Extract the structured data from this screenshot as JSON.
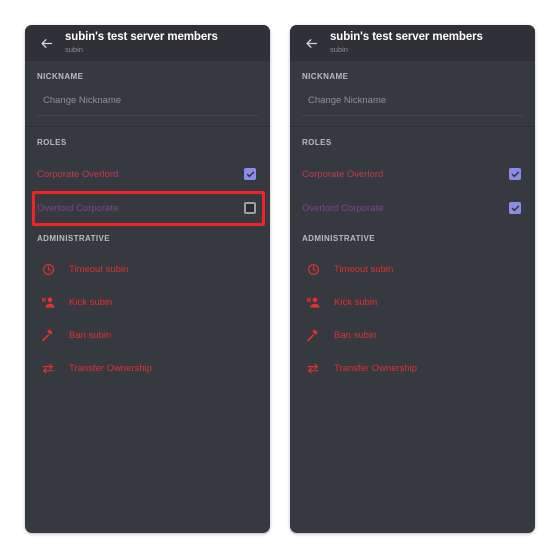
{
  "panels": [
    {
      "id": "left",
      "header": {
        "back_icon": "back-arrow-icon",
        "title": "subin's test server members",
        "subtitle": "subin"
      },
      "nickname": {
        "section_label": "NICKNAME",
        "placeholder": "Change Nickname",
        "value": ""
      },
      "roles": {
        "section_label": "ROLES",
        "items": [
          {
            "label": "Corporate Overlord",
            "color": "#c03b52",
            "checked": true,
            "highlighted": false
          },
          {
            "label": "Overlord Corporate",
            "color": "#81438c",
            "checked": false,
            "highlighted": true
          }
        ]
      },
      "administrative": {
        "section_label": "ADMINISTRATIVE",
        "items": [
          {
            "label": "Timeout subin",
            "icon": "clock-icon"
          },
          {
            "label": "Kick subin",
            "icon": "person-remove-icon"
          },
          {
            "label": "Ban subin",
            "icon": "gavel-icon"
          },
          {
            "label": "Transfer Ownership",
            "icon": "transfer-arrows-icon"
          }
        ]
      }
    },
    {
      "id": "right",
      "header": {
        "back_icon": "back-arrow-icon",
        "title": "subin's test server members",
        "subtitle": "subin"
      },
      "nickname": {
        "section_label": "NICKNAME",
        "placeholder": "Change Nickname",
        "value": ""
      },
      "roles": {
        "section_label": "ROLES",
        "items": [
          {
            "label": "Corporate Overlord",
            "color": "#c03b52",
            "checked": true,
            "highlighted": false
          },
          {
            "label": "Overlord Corporate",
            "color": "#81438c",
            "checked": true,
            "highlighted": false
          }
        ]
      },
      "administrative": {
        "section_label": "ADMINISTRATIVE",
        "items": [
          {
            "label": "Timeout subin",
            "icon": "clock-icon"
          },
          {
            "label": "Kick subin",
            "icon": "person-remove-icon"
          },
          {
            "label": "Ban subin",
            "icon": "gavel-icon"
          },
          {
            "label": "Transfer Ownership",
            "icon": "transfer-arrows-icon"
          }
        ]
      }
    }
  ],
  "colors": {
    "page_background": "#ffffff",
    "panel_background": "#36393f",
    "header_background": "#2f3136",
    "section_label": "#b9bbbe",
    "placeholder": "#8d9096",
    "admin_red": "#e03030",
    "checkbox_checked": "#8a8ce8",
    "highlight_border": "#f02424"
  }
}
